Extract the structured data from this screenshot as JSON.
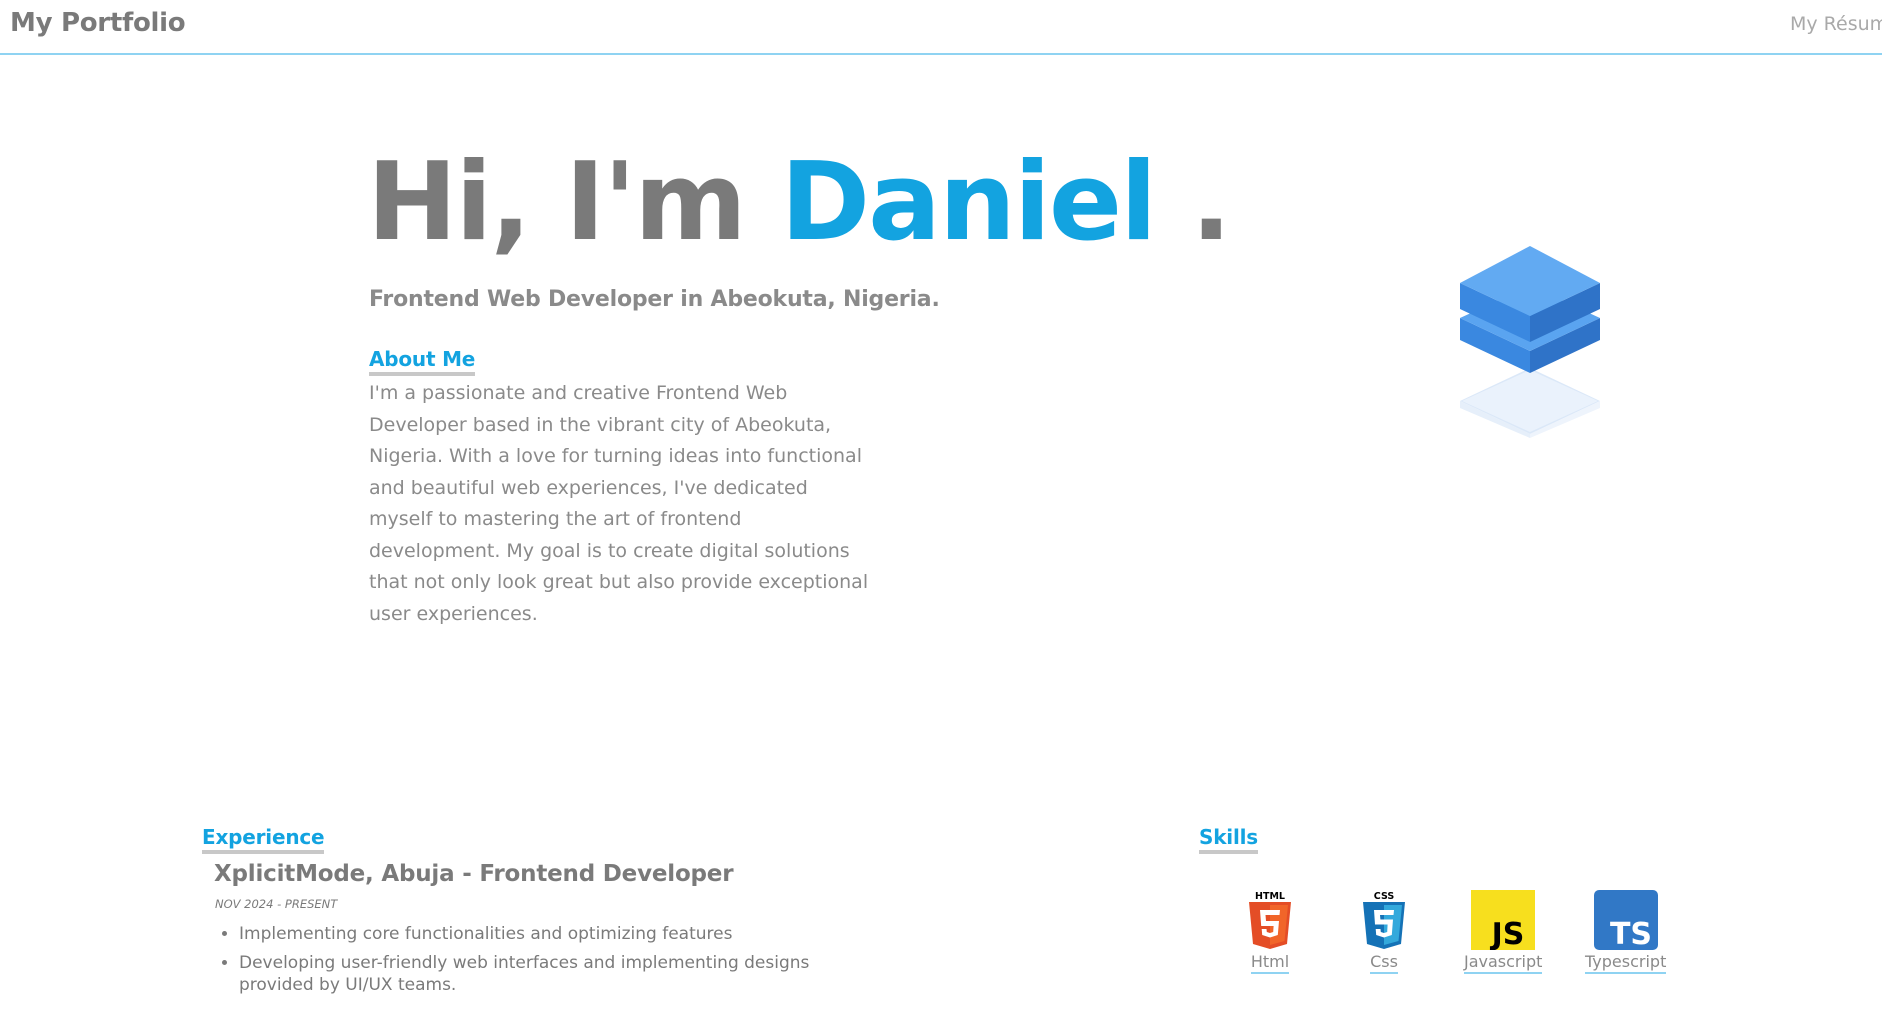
{
  "header": {
    "brand": "My Portfolio",
    "resume_link": "My Résumé"
  },
  "hero": {
    "greeting": "Hi, I'm",
    "name": "Daniel",
    "dot": ".",
    "subtitle": "Frontend Web Developer in Abeokuta, Nigeria."
  },
  "about": {
    "heading": "About Me",
    "text": "I'm a passionate and creative Frontend Web Developer based in the vibrant city of Abeokuta, Nigeria. With a love for turning ideas into functional and beautiful web experiences, I've dedicated myself to mastering the art of frontend development. My goal is to create digital solutions that not only look great but also provide exceptional user experiences."
  },
  "experience": {
    "heading": "Experience",
    "jobs": [
      {
        "title": "XplicitMode, Abuja - Frontend Developer",
        "date": "NOV 2024 - PRESENT",
        "bullets": [
          "Implementing core functionalities and optimizing features",
          "Developing user-friendly web interfaces and implementing designs provided by UI/UX teams."
        ]
      }
    ]
  },
  "skills": {
    "heading": "Skills",
    "items": [
      {
        "label": "Html",
        "icon": "html5-icon",
        "badge": "HTML",
        "color": "#e44d26"
      },
      {
        "label": "Css",
        "icon": "css3-icon",
        "badge": "CSS",
        "color": "#1572b6"
      },
      {
        "label": "Javascript",
        "icon": "javascript-icon",
        "badge": "JS",
        "color": "#f7df1e"
      },
      {
        "label": "Typescript",
        "icon": "typescript-icon",
        "badge": "TS",
        "color": "#3178c6"
      }
    ]
  },
  "colors": {
    "accent": "#13a3e0",
    "text": "#7a7a7a",
    "header_border": "#8fd3f2"
  }
}
